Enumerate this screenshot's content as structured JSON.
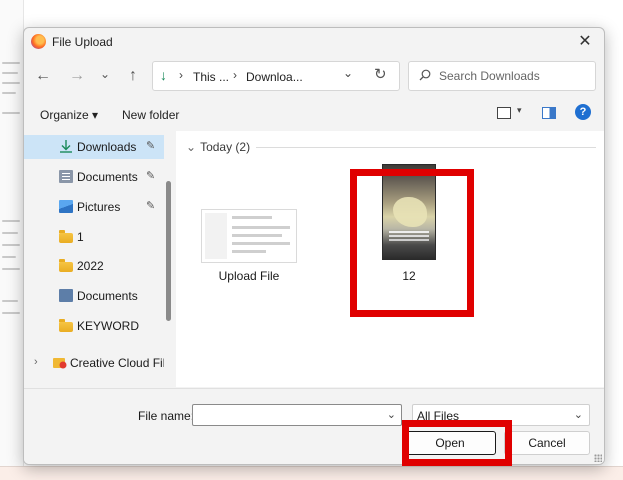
{
  "dialog": {
    "title": "File Upload",
    "close_symbol": "✕"
  },
  "nav": {
    "back_symbol": "←",
    "forward_symbol": "→",
    "recent_symbol": "⌄",
    "up_symbol": "↑",
    "refresh_symbol": "↻"
  },
  "address": {
    "icon_symbol": "↓",
    "segments": [
      "This ...",
      "Downloa..."
    ],
    "separator": "›",
    "dropdown_symbol": "⌄"
  },
  "search": {
    "placeholder": "Search Downloads"
  },
  "toolbar": {
    "organize_label": "Organize ▾",
    "new_folder_label": "New folder",
    "help_symbol": "?"
  },
  "sidebar": {
    "items": [
      {
        "label": "Downloads",
        "icon": "download-icon",
        "pinned": true,
        "selected": true
      },
      {
        "label": "Documents",
        "icon": "document-icon",
        "pinned": true
      },
      {
        "label": "Pictures",
        "icon": "picture-icon",
        "pinned": true
      },
      {
        "label": "1",
        "icon": "folder-icon"
      },
      {
        "label": "2022",
        "icon": "folder-icon"
      },
      {
        "label": "Documents",
        "icon": "document-icon"
      },
      {
        "label": "KEYWORD",
        "icon": "folder-icon"
      },
      {
        "label": "Creative Cloud File",
        "icon": "creative-cloud-icon"
      }
    ],
    "pin_symbol": "✎",
    "expand_symbol": "›"
  },
  "content": {
    "group_header": "Today (2)",
    "group_chevron": "⌄",
    "files": [
      {
        "name": "Upload File"
      },
      {
        "name": "12"
      }
    ]
  },
  "bottom": {
    "filename_label": "File name:",
    "filename_value": "",
    "filetype_value": "All Files",
    "dropdown_symbol": "⌄",
    "open_label": "Open",
    "cancel_label": "Cancel"
  },
  "colors": {
    "highlight": "#e00000",
    "selection": "#cce4f7",
    "accent": "#1f6fd1"
  }
}
